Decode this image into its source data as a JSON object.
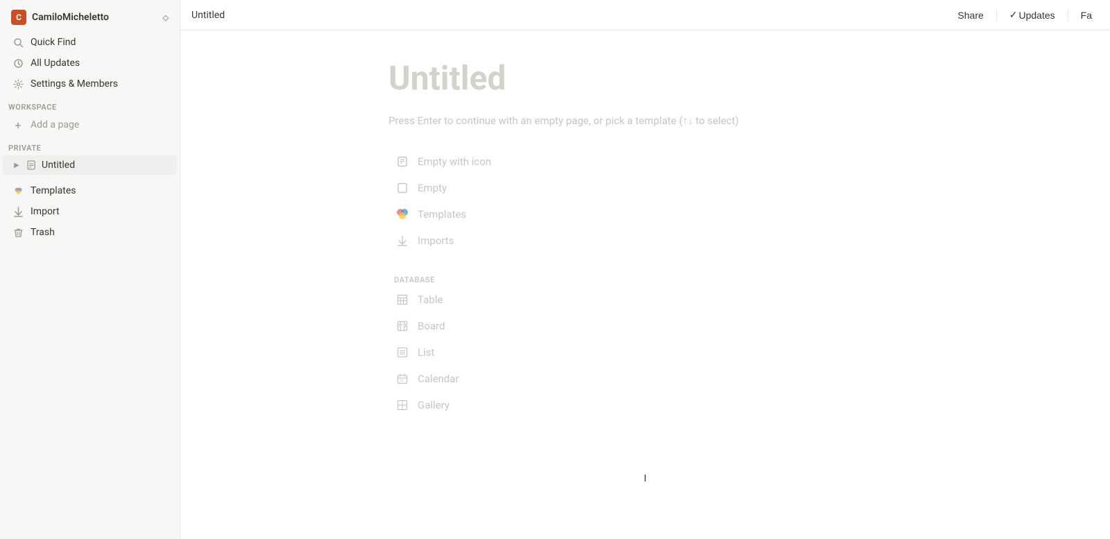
{
  "workspace": {
    "icon_letter": "C",
    "name": "CamiloMicheletto",
    "chevron": "◇"
  },
  "sidebar": {
    "nav_items": [
      {
        "id": "quick-find",
        "icon": "🔍",
        "label": "Quick Find"
      },
      {
        "id": "all-updates",
        "icon": "🕐",
        "label": "All Updates"
      },
      {
        "id": "settings-members",
        "icon": "⚙",
        "label": "Settings & Members"
      }
    ],
    "workspace_section": "WORKSPACE",
    "add_page_label": "Add a page",
    "private_section": "PRIVATE",
    "private_pages": [
      {
        "id": "untitled",
        "label": "Untitled"
      }
    ],
    "bottom_items": [
      {
        "id": "templates",
        "icon": "🎨",
        "label": "Templates"
      },
      {
        "id": "import",
        "icon": "⬇",
        "label": "Import"
      },
      {
        "id": "trash",
        "icon": "🗑",
        "label": "Trash"
      }
    ]
  },
  "topbar": {
    "title": "Untitled",
    "share_label": "Share",
    "check_icon": "✓",
    "updates_label": "Updates",
    "fav_label": "Fa"
  },
  "editor": {
    "page_title": "Untitled",
    "subtitle": "Press Enter to continue with an empty page, or pick a template (↑↓ to select)",
    "options": [
      {
        "id": "empty-with-icon",
        "icon": "📄",
        "label": "Empty with icon"
      },
      {
        "id": "empty",
        "icon": "📄",
        "label": "Empty"
      },
      {
        "id": "templates",
        "icon": "COLORED",
        "label": "Templates"
      },
      {
        "id": "imports",
        "icon": "⬇",
        "label": "Imports"
      }
    ],
    "database_label": "DATABASE",
    "database_options": [
      {
        "id": "table",
        "icon": "TABLE",
        "label": "Table"
      },
      {
        "id": "board",
        "icon": "BOARD",
        "label": "Board"
      },
      {
        "id": "list",
        "icon": "LIST",
        "label": "List"
      },
      {
        "id": "calendar",
        "icon": "CALENDAR",
        "label": "Calendar"
      },
      {
        "id": "gallery",
        "icon": "GALLERY",
        "label": "Gallery"
      }
    ],
    "cursor_char": "I"
  }
}
